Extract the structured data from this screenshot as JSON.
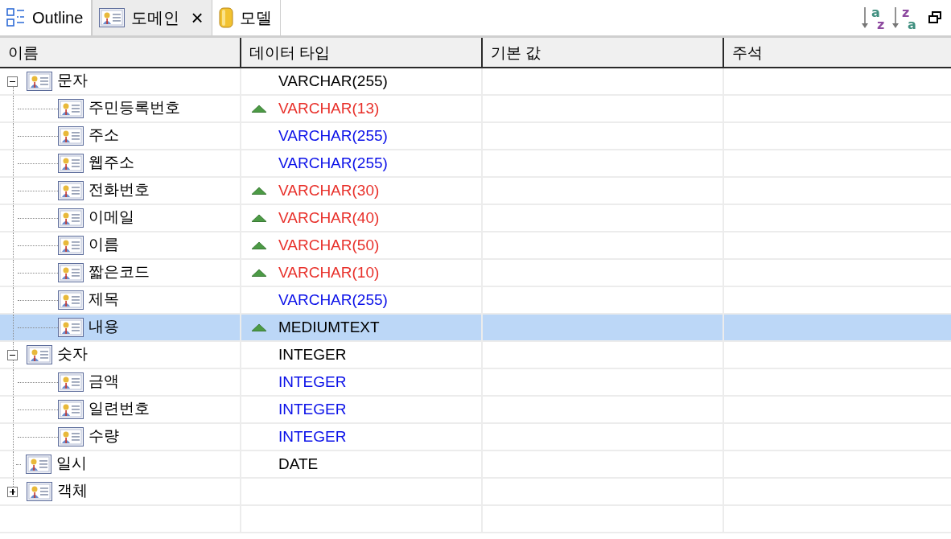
{
  "tabs": [
    {
      "label": "Outline",
      "selected": false
    },
    {
      "label": "도메인",
      "selected": true,
      "close": "×"
    },
    {
      "label": "모델",
      "selected": false
    }
  ],
  "sort_buttons": [
    {
      "top": "a",
      "bottom": "z"
    },
    {
      "top": "z",
      "bottom": "a"
    }
  ],
  "table": {
    "columns": [
      "이름",
      "데이터 타입",
      "기본 값",
      "주석"
    ],
    "rows": [
      {
        "name": "문자",
        "type": "VARCHAR(255)",
        "kind": "base",
        "expanded": true,
        "selected": false,
        "children": [
          {
            "name": "주민등록번호",
            "type": "VARCHAR(13)",
            "kind": "overridden",
            "selected": false
          },
          {
            "name": "주소",
            "type": "VARCHAR(255)",
            "kind": "inherited",
            "selected": false
          },
          {
            "name": "웹주소",
            "type": "VARCHAR(255)",
            "kind": "inherited",
            "selected": false
          },
          {
            "name": "전화번호",
            "type": "VARCHAR(30)",
            "kind": "overridden",
            "selected": false
          },
          {
            "name": "이메일",
            "type": "VARCHAR(40)",
            "kind": "overridden",
            "selected": false
          },
          {
            "name": "이름",
            "type": "VARCHAR(50)",
            "kind": "overridden",
            "selected": false
          },
          {
            "name": "짧은코드",
            "type": "VARCHAR(10)",
            "kind": "overridden",
            "selected": false
          },
          {
            "name": "제목",
            "type": "VARCHAR(255)",
            "kind": "inherited",
            "selected": false
          },
          {
            "name": "내용",
            "type": "MEDIUMTEXT",
            "kind": "overridden",
            "selected": true
          }
        ]
      },
      {
        "name": "숫자",
        "type": "INTEGER",
        "kind": "base",
        "expanded": true,
        "selected": false,
        "children": [
          {
            "name": "금액",
            "type": "INTEGER",
            "kind": "inherited",
            "selected": false
          },
          {
            "name": "일련번호",
            "type": "INTEGER",
            "kind": "inherited",
            "selected": false
          },
          {
            "name": "수량",
            "type": "INTEGER",
            "kind": "inherited",
            "selected": false
          }
        ]
      },
      {
        "name": "일시",
        "type": "DATE",
        "kind": "base",
        "selected": false
      },
      {
        "name": "객체",
        "kind": "base",
        "expanded": false,
        "selected": false,
        "children": []
      }
    ]
  }
}
